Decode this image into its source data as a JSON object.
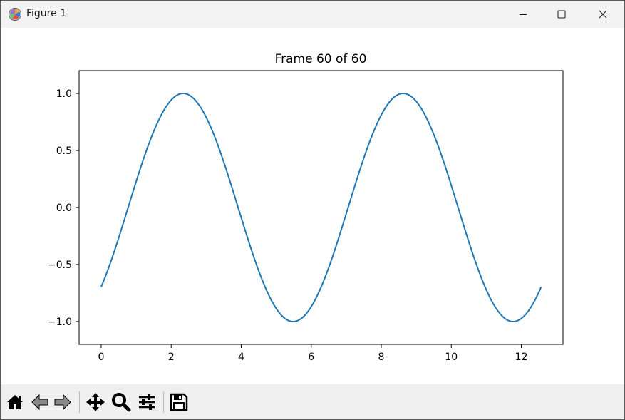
{
  "window": {
    "title": "Figure 1"
  },
  "controls": {
    "minimize": "minimize-icon",
    "maximize": "maximize-icon",
    "close": "close-icon"
  },
  "toolbar": {
    "buttons": [
      "home-icon",
      "back-icon",
      "forward-icon",
      "pan-icon",
      "zoom-icon",
      "configure-subplots-icon",
      "save-icon"
    ]
  },
  "colors": {
    "line": "#1f77b4"
  },
  "chart_data": {
    "type": "line",
    "title": "Frame 60 of 60",
    "function": "sin(x - 0.77)",
    "x_range": [
      0,
      12.566
    ],
    "xlim": [
      -0.63,
      13.19
    ],
    "ylim": [
      -1.2,
      1.2
    ],
    "xticks": [
      0,
      2,
      4,
      6,
      8,
      10,
      12
    ],
    "yticks": [
      1.0,
      0.5,
      0.0,
      -0.5,
      -1.0
    ],
    "xtick_labels": [
      "0",
      "2",
      "4",
      "6",
      "8",
      "10",
      "12"
    ],
    "ytick_labels": [
      "1.0",
      "0.5",
      "0.0",
      "−0.5",
      "−1.0"
    ],
    "series": [
      {
        "x": [
          0,
          0.5,
          1,
          1.5,
          2,
          2.34,
          2.5,
          3,
          3.5,
          4,
          4.5,
          5,
          5.48,
          6,
          6.5,
          7,
          7.5,
          8,
          8.63,
          9,
          9.5,
          10,
          10.5,
          11,
          11.5,
          11.77,
          12,
          12.566
        ],
        "y": [
          -0.7,
          -0.27,
          0.23,
          0.66,
          0.95,
          1.0,
          0.99,
          0.79,
          0.41,
          -0.07,
          -0.53,
          -0.88,
          -1.0,
          -0.86,
          -0.5,
          -0.03,
          0.44,
          0.81,
          1.0,
          0.93,
          0.63,
          0.19,
          -0.3,
          -0.72,
          -0.97,
          -1.0,
          -0.97,
          -0.7
        ]
      }
    ]
  }
}
